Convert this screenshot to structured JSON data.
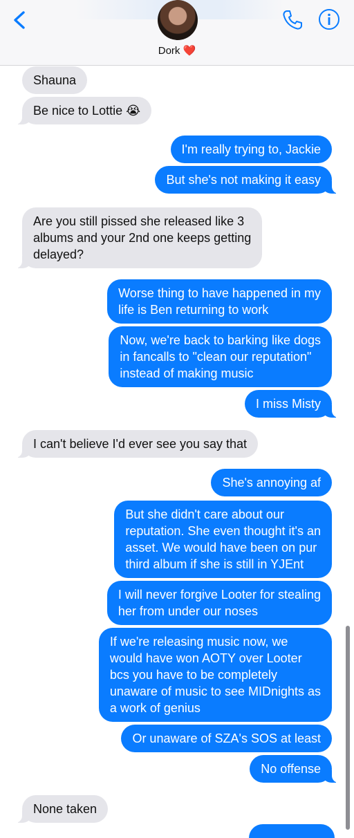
{
  "header": {
    "contact_name": "Dork ❤️",
    "icons": {
      "back": "chevron-left-icon",
      "phone": "phone-icon",
      "info": "info-icon"
    },
    "accent_color": "#0a7cff"
  },
  "messages": [
    {
      "direction": "incoming",
      "text": "Shauna"
    },
    {
      "direction": "incoming",
      "text": "Be nice to Lottie 😭"
    },
    {
      "direction": "outgoing",
      "text": "I'm really trying to, Jackie"
    },
    {
      "direction": "outgoing",
      "text": "But she's not making it easy"
    },
    {
      "direction": "incoming",
      "lines": [
        "Are you still pissed she released like 3",
        "albums and your 2nd one keeps getting",
        "delayed?"
      ]
    },
    {
      "direction": "outgoing",
      "lines": [
        "Worse thing to have happened in my",
        "life is Ben returning to work"
      ]
    },
    {
      "direction": "outgoing",
      "lines": [
        "Now, we're back to barking like dogs",
        "in fancalls to \"clean our reputation\"",
        "instead of making music"
      ]
    },
    {
      "direction": "outgoing",
      "text": "I miss Misty"
    },
    {
      "direction": "incoming",
      "text": "I can't believe I'd ever see you say that"
    },
    {
      "direction": "outgoing",
      "text": "She's annoying af"
    },
    {
      "direction": "outgoing",
      "lines": [
        "But she didn't care about our",
        "reputation. She even thought it's an",
        "asset. We would have been on pur",
        "third album if she is still in YJEnt"
      ]
    },
    {
      "direction": "outgoing",
      "lines": [
        "I will never forgive Looter for stealing",
        "her from under our noses"
      ]
    },
    {
      "direction": "outgoing",
      "lines": [
        "If we're releasing music now, we",
        "would have won AOTY over Looter",
        "bcs you have to be completely",
        "unaware of music to see MIDnights as",
        "a work of genius"
      ]
    },
    {
      "direction": "outgoing",
      "text": "Or unaware of SZA's SOS at least"
    },
    {
      "direction": "outgoing",
      "text": "No offense"
    },
    {
      "direction": "incoming",
      "text": "None taken"
    }
  ]
}
